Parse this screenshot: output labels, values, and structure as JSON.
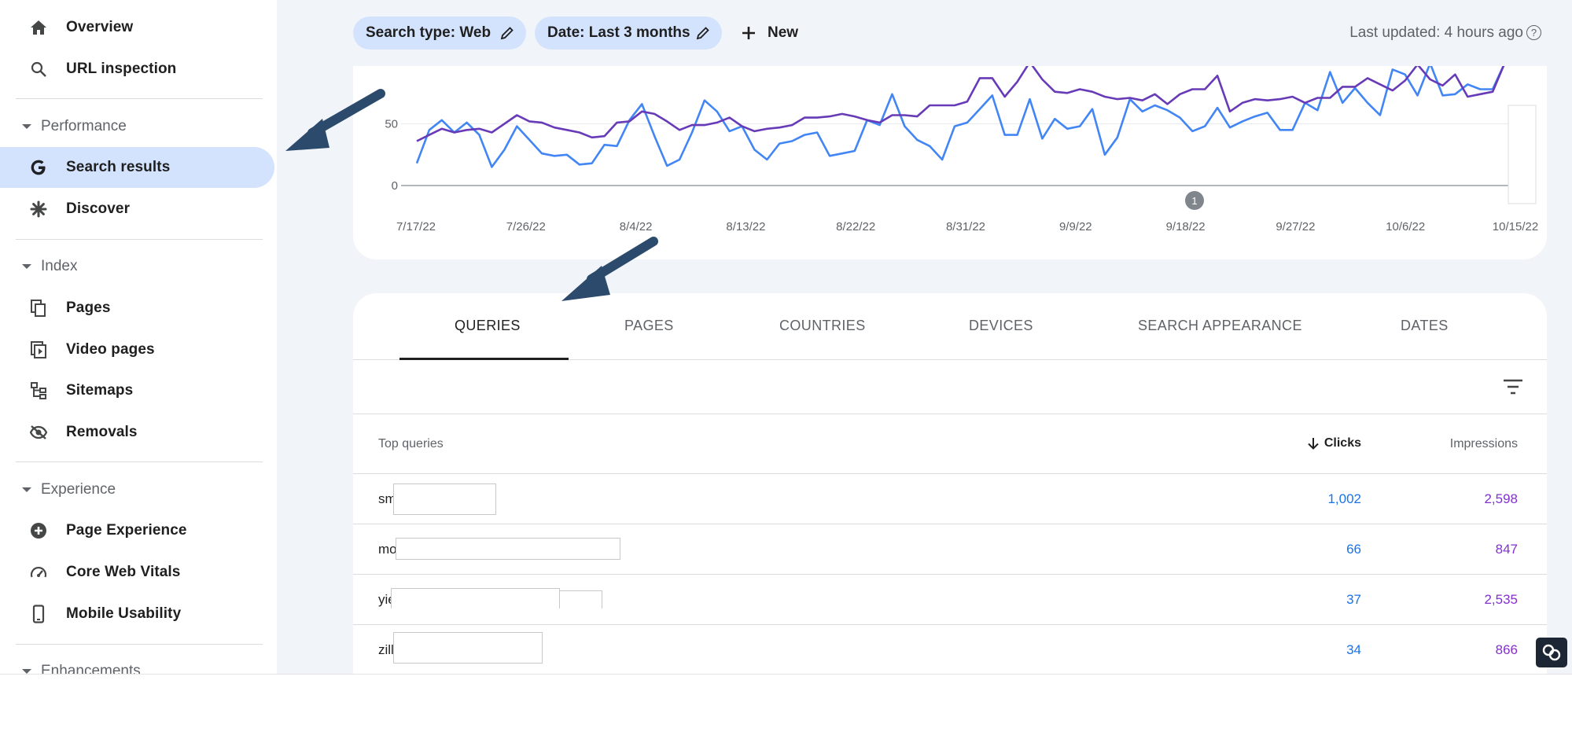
{
  "sidebar": {
    "top_items": [
      {
        "label": "Overview",
        "icon": "home-icon"
      },
      {
        "label": "URL inspection",
        "icon": "search-icon"
      }
    ],
    "sections": [
      {
        "label": "Performance",
        "items": [
          {
            "label": "Search results",
            "icon": "google-g-icon",
            "active": true
          },
          {
            "label": "Discover",
            "icon": "asterisk-icon"
          }
        ]
      },
      {
        "label": "Index",
        "items": [
          {
            "label": "Pages",
            "icon": "pages-icon"
          },
          {
            "label": "Video pages",
            "icon": "video-pages-icon"
          },
          {
            "label": "Sitemaps",
            "icon": "sitemap-icon"
          },
          {
            "label": "Removals",
            "icon": "eye-off-icon"
          }
        ]
      },
      {
        "label": "Experience",
        "items": [
          {
            "label": "Page Experience",
            "icon": "plus-circle-icon"
          },
          {
            "label": "Core Web Vitals",
            "icon": "gauge-icon"
          },
          {
            "label": "Mobile Usability",
            "icon": "phone-icon"
          }
        ]
      },
      {
        "label": "Enhancements",
        "items": []
      }
    ]
  },
  "toolbar": {
    "search_type_chip": "Search type: Web",
    "date_chip": "Date: Last 3 months",
    "new_label": "New",
    "last_updated": "Last updated: 4 hours ago"
  },
  "chart_data": {
    "type": "line",
    "x_tick_labels": [
      "7/17/22",
      "7/26/22",
      "8/4/22",
      "8/13/22",
      "8/22/22",
      "8/31/22",
      "9/9/22",
      "9/18/22",
      "9/27/22",
      "10/6/22",
      "10/15/22"
    ],
    "y_tick_labels": [
      "0",
      "50"
    ],
    "ylim": [
      0,
      100
    ],
    "annotation_marker": "1",
    "series": [
      {
        "color": "#4285f4",
        "values": [
          18,
          45,
          53,
          43,
          51,
          41,
          15,
          29,
          48,
          37,
          26,
          24,
          25,
          17,
          18,
          33,
          32,
          53,
          66,
          40,
          16,
          21,
          43,
          69,
          60,
          44,
          48,
          29,
          21,
          34,
          36,
          41,
          43,
          24,
          26,
          28,
          53,
          49,
          74,
          48,
          37,
          32,
          21,
          48,
          51,
          62,
          73,
          41,
          41,
          70,
          38,
          54,
          46,
          48,
          62,
          25,
          39,
          70,
          60,
          65,
          61,
          55,
          44,
          48,
          63,
          47,
          52,
          56,
          59,
          45,
          45,
          67,
          61,
          92,
          67,
          79,
          67,
          57,
          94,
          90,
          73,
          99,
          73,
          74,
          82,
          78,
          78,
          100
        ]
      },
      {
        "color": "#673ab7",
        "values": [
          36,
          41,
          46,
          43,
          45,
          46,
          43,
          50,
          57,
          52,
          51,
          47,
          45,
          43,
          39,
          40,
          51,
          52,
          60,
          58,
          52,
          45,
          49,
          49,
          51,
          55,
          48,
          44,
          46,
          47,
          49,
          55,
          55,
          56,
          58,
          56,
          53,
          51,
          57,
          57,
          56,
          65,
          65,
          65,
          68,
          87,
          87,
          72,
          84,
          100,
          86,
          76,
          75,
          78,
          76,
          72,
          70,
          71,
          69,
          74,
          66,
          74,
          78,
          78,
          89,
          60,
          67,
          70,
          69,
          70,
          72,
          67,
          71,
          71,
          80,
          80,
          87,
          82,
          77,
          85,
          98,
          86,
          81,
          90,
          72,
          74,
          76,
          100
        ]
      }
    ]
  },
  "tabs": [
    "QUERIES",
    "PAGES",
    "COUNTRIES",
    "DEVICES",
    "SEARCH APPEARANCE",
    "DATES"
  ],
  "table": {
    "headers": {
      "queries": "Top queries",
      "clicks": "Clicks",
      "impressions": "Impressions"
    },
    "rows": [
      {
        "query": "sm",
        "clicks": "1,002",
        "impressions": "2,598"
      },
      {
        "query": "mo",
        "clicks": "66",
        "impressions": "847"
      },
      {
        "query": "yie",
        "clicks": "37",
        "impressions": "2,535"
      },
      {
        "query": "zill",
        "clicks": "34",
        "impressions": "866"
      }
    ]
  },
  "colors": {
    "accent": "#1a73e8",
    "impressions": "#8430ce",
    "active_nav": "#d3e3fd",
    "arrow": "#2c4a6b"
  }
}
